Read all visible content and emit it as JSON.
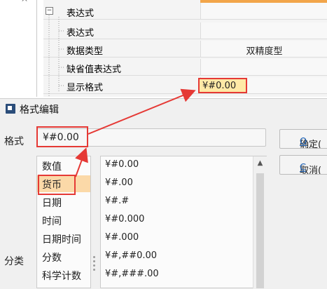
{
  "property_grid": {
    "rows": [
      {
        "label": "表达式",
        "value": ""
      },
      {
        "label": "表达式",
        "value": ""
      },
      {
        "label": "数据类型",
        "value": "双精度型"
      },
      {
        "label": "缺省值表达式",
        "value": ""
      },
      {
        "label": "显示格式",
        "value": "¥#0.00"
      }
    ],
    "expander_symbol": "−"
  },
  "dialog": {
    "title": "格式编辑",
    "format_label": "格式",
    "format_value": "¥#0.00",
    "ok_label_main": "确定(",
    "ok_label_key": "O",
    "cancel_label_main": "取消(",
    "cancel_label_key": "C",
    "category_label": "分类",
    "categories": [
      "数值",
      "货币",
      "日期",
      "时间",
      "日期时间",
      "分数",
      "科学计数"
    ],
    "selected_category_index": 1,
    "formats": [
      "¥#0.00",
      "¥#.00",
      "¥#.#",
      "¥#0.000",
      "¥#.000",
      "¥#,##0.00",
      "¥#,###.00"
    ]
  },
  "colors": {
    "highlight_red": "#e53935",
    "selection": "#fbd9a8",
    "value_highlight": "#ffe9a6",
    "accent_orange": "#f2a54a"
  }
}
